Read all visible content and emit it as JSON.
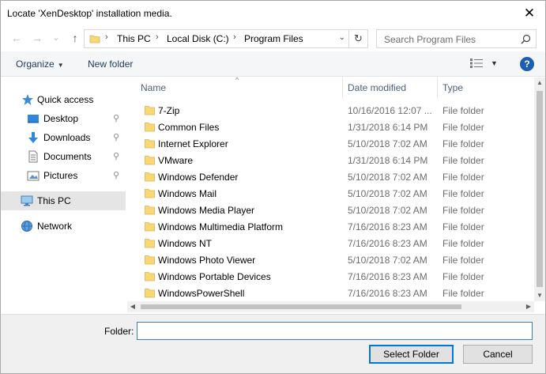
{
  "window": {
    "title": "Locate 'XenDesktop' installation media.",
    "close_glyph": "✕"
  },
  "nav": {
    "back_glyph": "←",
    "forward_glyph": "→",
    "recent_glyph": "⌄",
    "up_glyph": "↑",
    "breadcrumb": [
      "This PC",
      "Local Disk (C:)",
      "Program Files"
    ],
    "separator_glyph": "›",
    "dropdown_glyph": "⌄",
    "refresh_glyph": "↻"
  },
  "search": {
    "placeholder": "Search Program Files",
    "icon_glyph": "⚲"
  },
  "toolbar": {
    "organize_label": "Organize",
    "organize_caret": "▼",
    "new_folder_label": "New folder",
    "view_caret": "▼",
    "help_label": "?"
  },
  "sidebar": {
    "items": [
      {
        "label": "Quick access",
        "icon": "star-icon",
        "pinned": false
      },
      {
        "label": "Desktop",
        "icon": "desktop-icon",
        "pinned": true
      },
      {
        "label": "Downloads",
        "icon": "download-arrow-icon",
        "pinned": true
      },
      {
        "label": "Documents",
        "icon": "document-icon",
        "pinned": true
      },
      {
        "label": "Pictures",
        "icon": "picture-icon",
        "pinned": true
      },
      {
        "label": "This PC",
        "icon": "monitor-icon",
        "pinned": false,
        "selected": true
      },
      {
        "label": "Network",
        "icon": "network-icon",
        "pinned": false
      }
    ],
    "pin_glyph": "📌"
  },
  "file_list": {
    "columns": {
      "name": "Name",
      "date": "Date modified",
      "type": "Type"
    },
    "sort_glyph": "^",
    "rows": [
      {
        "name": "7-Zip",
        "date": "10/16/2016 12:07 ...",
        "type": "File folder"
      },
      {
        "name": "Common Files",
        "date": "1/31/2018 6:14 PM",
        "type": "File folder"
      },
      {
        "name": "Internet Explorer",
        "date": "5/10/2018 7:02 AM",
        "type": "File folder"
      },
      {
        "name": "VMware",
        "date": "1/31/2018 6:14 PM",
        "type": "File folder"
      },
      {
        "name": "Windows Defender",
        "date": "5/10/2018 7:02 AM",
        "type": "File folder"
      },
      {
        "name": "Windows Mail",
        "date": "5/10/2018 7:02 AM",
        "type": "File folder"
      },
      {
        "name": "Windows Media Player",
        "date": "5/10/2018 7:02 AM",
        "type": "File folder"
      },
      {
        "name": "Windows Multimedia Platform",
        "date": "7/16/2016 8:23 AM",
        "type": "File folder"
      },
      {
        "name": "Windows NT",
        "date": "7/16/2016 8:23 AM",
        "type": "File folder"
      },
      {
        "name": "Windows Photo Viewer",
        "date": "5/10/2018 7:02 AM",
        "type": "File folder"
      },
      {
        "name": "Windows Portable Devices",
        "date": "7/16/2016 8:23 AM",
        "type": "File folder"
      },
      {
        "name": "WindowsPowerShell",
        "date": "7/16/2016 8:23 AM",
        "type": "File folder"
      }
    ]
  },
  "scroll": {
    "up_glyph": "▲",
    "down_glyph": "▼",
    "left_glyph": "◀",
    "right_glyph": "▶"
  },
  "bottom": {
    "folder_label": "Folder:",
    "folder_value": "",
    "select_label": "Select Folder",
    "cancel_label": "Cancel"
  },
  "colors": {
    "accent": "#0078d7",
    "selection_bg": "#e5e5e5",
    "folder_yellow": "#f8d775",
    "header_text": "#4c607a",
    "muted_text": "#6d6d6d"
  }
}
